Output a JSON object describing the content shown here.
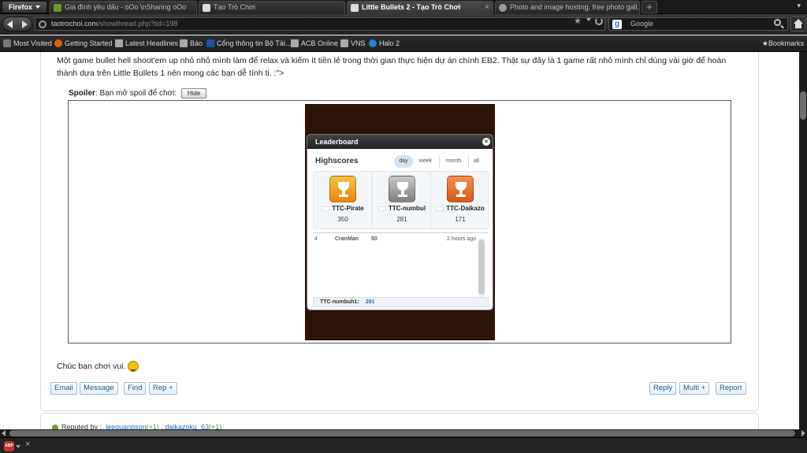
{
  "browser": {
    "menu_label": "Firefox",
    "tabs": [
      {
        "label": "Gia đình yêu dấu - oOo \\nSharing oOo",
        "icon_color": "#6a9a2a",
        "active": false
      },
      {
        "label": "Tạo Trò Chơi",
        "icon_color": "#dddddd",
        "active": false
      },
      {
        "label": "Little Bullets 2 - Tạo Trò Chơi",
        "icon_color": "#dddddd",
        "active": true
      },
      {
        "label": "Photo and image hosting, free photo gall...",
        "icon_color": "#999999",
        "active": false
      }
    ],
    "new_tab": "+",
    "url_host": "taotrochoi.com",
    "url_path": "/showthread.php?tid=198",
    "search_placeholder": "Google",
    "search_engine_letter": "g",
    "bookmarks": [
      {
        "label": "Most Visited",
        "icon_color": "#777777"
      },
      {
        "label": "Getting Started",
        "icon_color": "#e66000"
      },
      {
        "label": "Latest Headlines",
        "icon_color": "#aaaaaa"
      },
      {
        "label": "Báo",
        "icon_color": "#aaaaaa"
      },
      {
        "label": "Cổng thông tin Bộ Tài...",
        "icon_color": "#1e4fa8"
      },
      {
        "label": "ACB Online",
        "icon_color": "#aaaaaa"
      },
      {
        "label": "VNS",
        "icon_color": "#aaaaaa"
      },
      {
        "label": "Halo 2",
        "icon_color": "#2a7fd6"
      }
    ],
    "bookmarks_menu": "Bookmarks"
  },
  "post": {
    "body": "Một game bullet hell shoot'em up nhỏ nhỏ mình làm để relax và kiếm ít tiền lẻ trong thời gian thực hiện dự án chính EB2. Thật sự đây là 1 game rất nhỏ mình chỉ dùng vài giờ để hoàn thành dựa trên Little Bullets 1 nên mong các bạn dễ tính ti. :\">",
    "spoiler_label": "Spoiler",
    "spoiler_text": ": Bạn mở spoil để chơi:",
    "hide_button": "Hide",
    "closing": "Chúc bạn chơi vui.",
    "buttons_left": [
      "Email",
      "Message",
      "Find",
      "Rep +"
    ],
    "buttons_right": [
      "Reply",
      "Multi +",
      "Report"
    ]
  },
  "leaderboard": {
    "title": "Leaderboard",
    "close": "×",
    "highscores_label": "Highscores",
    "filters": [
      "day",
      "week",
      "month",
      "all"
    ],
    "active_filter": "day",
    "podium": [
      {
        "name": "TTC-Pirate",
        "score": "350",
        "color": "#f0a020"
      },
      {
        "name": "TTC-numbul",
        "score": "281",
        "color": "#9a9a9a"
      },
      {
        "name": "TTC-Daikazo",
        "score": "171",
        "color": "#e8672a"
      }
    ],
    "rows": [
      {
        "rank": "4",
        "name": "CranMan",
        "score": "50",
        "time": "2 hours ago"
      }
    ],
    "my_name": "TTC-numbuh1:",
    "my_score": "291"
  },
  "reputation": {
    "label": "Reputed by :",
    "users": [
      {
        "name": "leequangson",
        "points": "(+1)"
      },
      {
        "name": "daikazoku_63",
        "points": "(+1)"
      }
    ],
    "separator": " , "
  },
  "statusbar": {
    "abp_label": "ABP",
    "close": "×"
  }
}
